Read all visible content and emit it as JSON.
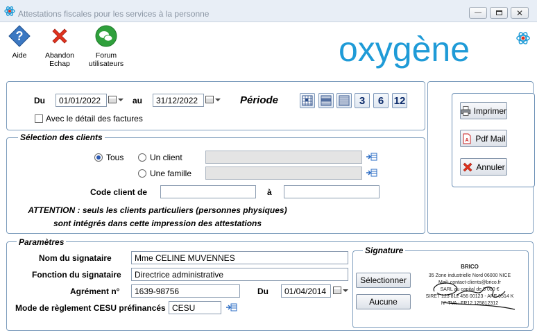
{
  "window": {
    "title": "Attestations fiscales pour les services à la personne"
  },
  "toolbar": {
    "help_label": "Aide",
    "abandon_label_1": "Abandon",
    "abandon_label_2": "Echap",
    "forum_label_1": "Forum",
    "forum_label_2": "utilisateurs"
  },
  "logo": {
    "text": "oxygène"
  },
  "period": {
    "from_label": "Du",
    "from_value": "01/01/2022",
    "to_label": "au",
    "to_value": "31/12/2022",
    "title": "Période",
    "buttons": [
      "3",
      "6",
      "12"
    ],
    "detail_label": "Avec le détail des factures"
  },
  "clients": {
    "legend": "Sélection des clients",
    "all_label": "Tous",
    "one_label": "Un client",
    "family_label": "Une famille",
    "code_from_label": "Code client de",
    "code_to_label": "à",
    "warning_1": "ATTENTION : seuls les clients particuliers (personnes physiques)",
    "warning_2": "sont intégrés dans cette impression des attestations"
  },
  "actions": {
    "print_label": "Imprimer",
    "pdf_label": "Pdf Mail",
    "cancel_label": "Annuler"
  },
  "params": {
    "legend": "Paramètres",
    "signatory_label": "Nom du signataire",
    "signatory_value": "Mme CELINE MUVENNES",
    "function_label": "Fonction du signataire",
    "function_value": "Directrice administrative",
    "agrement_label": "Agrément n°",
    "agrement_value": "1639-98756",
    "agrement_date_label": "Du",
    "agrement_date_value": "01/04/2014",
    "cesu_label": "Mode de règlement CESU préfinancés",
    "cesu_value": "CESU"
  },
  "signature": {
    "legend": "Signature",
    "select_label": "Sélectionner",
    "none_label": "Aucune",
    "company": "BRICO",
    "line1": "35 Zone industrielle Nord     06000 NICE",
    "line2": "Mail: contact-clients@brico.fr",
    "line3": "SARL au capital de 5 000 €",
    "line4": "SIRET 123 812 456 00123  -  APE 9514 K",
    "line5": "N° TVA : FR12 125812312"
  },
  "colors": {
    "logo_blue": "#1f9bd7",
    "group_border": "#7c9cbc",
    "help_icon": "#3b78c2",
    "abandon_icon": "#e0321e",
    "forum_icon": "#2fa03c"
  }
}
